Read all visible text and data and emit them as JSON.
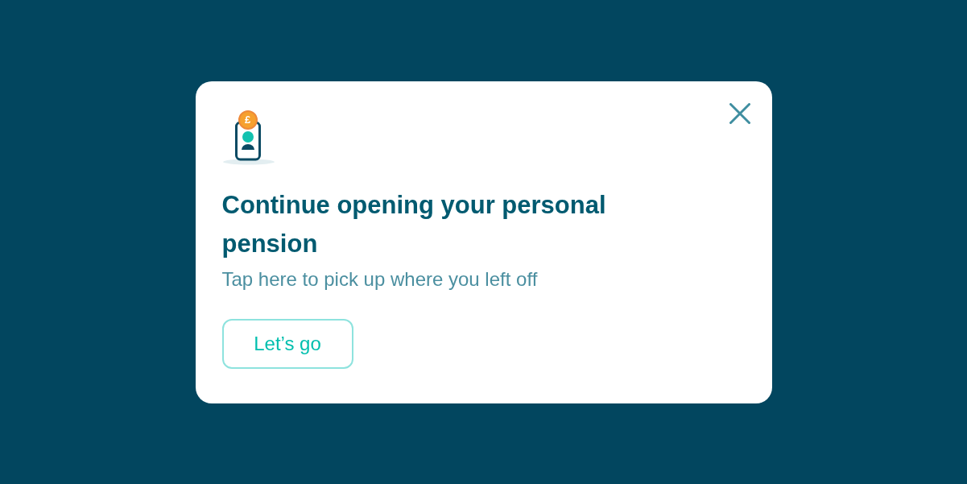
{
  "dialog": {
    "coin_symbol": "£",
    "title": "Continue opening your personal pension",
    "subtitle": "Tap here to pick up where you left off",
    "button": "Let’s go"
  }
}
